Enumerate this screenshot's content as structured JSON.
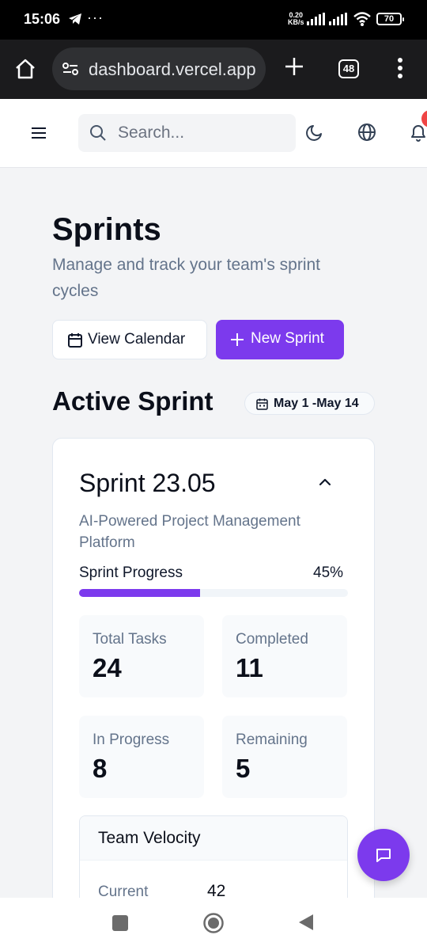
{
  "status_bar": {
    "time": "15:06",
    "more": "···",
    "net_speed_value": "0.20",
    "net_speed_unit": "KB/s",
    "battery": "70"
  },
  "browser": {
    "url": "dashboard.vercel.app",
    "tab_count": "48"
  },
  "header": {
    "search_placeholder": "Search...",
    "notification_color": "#ef4444"
  },
  "page": {
    "title": "Sprints",
    "subtitle": "Manage and track your team's sprint cycles",
    "buttons": {
      "view_calendar": "View Calendar",
      "new_sprint": "New Sprint"
    }
  },
  "active_sprint": {
    "section_title": "Active Sprint",
    "date_range": "May 1 -May 14",
    "name": "Sprint 23.05",
    "description": "AI-Powered Project Management Platform",
    "progress_label": "Sprint Progress",
    "progress_text": "45%",
    "progress_fraction": 0.45,
    "stats": {
      "total_label": "Total Tasks",
      "total_value": "24",
      "completed_label": "Completed",
      "completed_value": "11",
      "in_progress_label": "In Progress",
      "in_progress_value": "8",
      "remaining_label": "Remaining",
      "remaining_value": "5"
    },
    "velocity": {
      "title": "Team Velocity",
      "current_label": "Current",
      "current_value": "42"
    }
  },
  "colors": {
    "accent": "#7c3aed",
    "background": "#f3f4f6",
    "text_muted": "#64748b"
  },
  "icons": {
    "status": [
      "telegram-icon",
      "signal-icon",
      "wifi-icon",
      "battery-icon"
    ],
    "browser": [
      "home-icon",
      "site-settings-icon",
      "new-tab-icon",
      "tabs-icon",
      "more-vertical-icon"
    ],
    "header": [
      "hamburger-menu-icon",
      "search-icon",
      "moon-icon",
      "globe-icon",
      "bell-icon"
    ],
    "content": [
      "calendar-icon",
      "plus-icon",
      "chevron-up-icon",
      "chat-icon"
    ],
    "nav": [
      "recents-icon",
      "home-circle-icon",
      "back-icon"
    ]
  }
}
